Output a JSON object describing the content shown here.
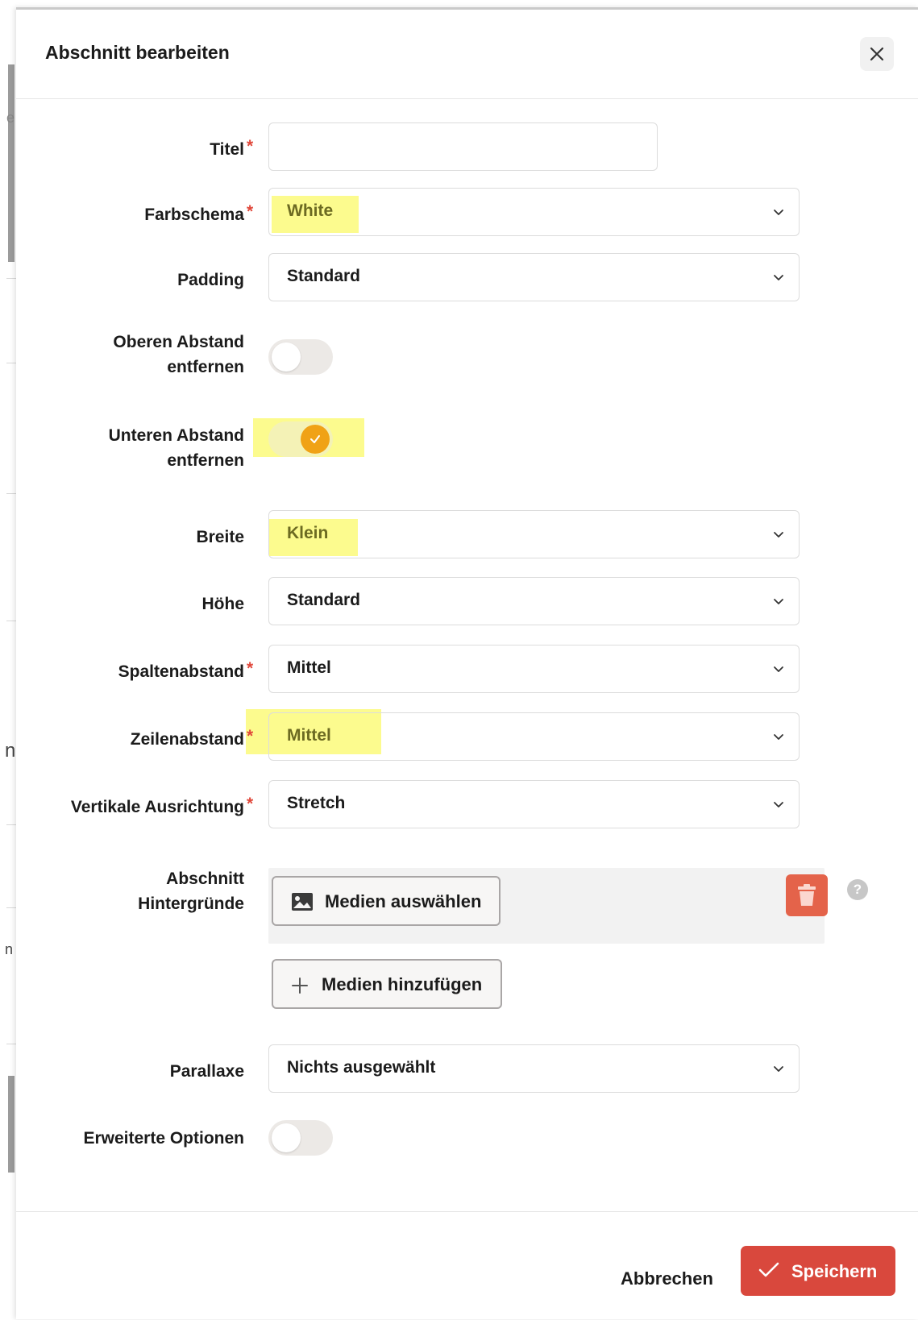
{
  "dialog": {
    "title": "Abschnitt bearbeiten",
    "close_icon": "close-icon"
  },
  "fields": {
    "titel": {
      "label": "Titel",
      "required_mark": "*",
      "value": ""
    },
    "farbschema": {
      "label": "Farbschema",
      "required_mark": "*",
      "value": "White"
    },
    "padding": {
      "label": "Padding",
      "value": "Standard"
    },
    "oberen_abstand": {
      "label_line1": "Oberen Abstand",
      "label_line2": "entfernen",
      "checked": false
    },
    "unteren_abstand": {
      "label_line1": "Unteren Abstand",
      "label_line2": "entfernen",
      "checked": true
    },
    "breite": {
      "label": "Breite",
      "value": "Klein"
    },
    "hoehe": {
      "label": "Höhe",
      "value": "Standard"
    },
    "spaltenabstand": {
      "label": "Spaltenabstand",
      "required_mark": "*",
      "value": "Mittel"
    },
    "zeilenabstand": {
      "label": "Zeilenabstand",
      "required_mark": "*",
      "value": "Mittel"
    },
    "vertikale_ausrichtung": {
      "label": "Vertikale Ausrichtung",
      "required_mark": "*",
      "value": "Stretch"
    },
    "hintergruende": {
      "label_line1": "Abschnitt",
      "label_line2": "Hintergründe",
      "select_media_label": "Medien auswählen",
      "add_media_label": "Medien hinzufügen",
      "help_glyph": "?"
    },
    "parallaxe": {
      "label": "Parallaxe",
      "value": "Nichts ausgewählt"
    },
    "erweiterte_optionen": {
      "label": "Erweiterte Optionen",
      "checked": false
    }
  },
  "footer": {
    "cancel_label": "Abbrechen",
    "save_label": "Speichern"
  },
  "background_peek": {
    "glyph_1": "e",
    "glyph_2": "n",
    "glyph_3": "n"
  },
  "colors": {
    "required": "#e0473a",
    "toggle_on": "#f0a216",
    "save_button": "#d9483d",
    "trash_button": "#e4634a",
    "highlight": "#fbfa7a"
  }
}
